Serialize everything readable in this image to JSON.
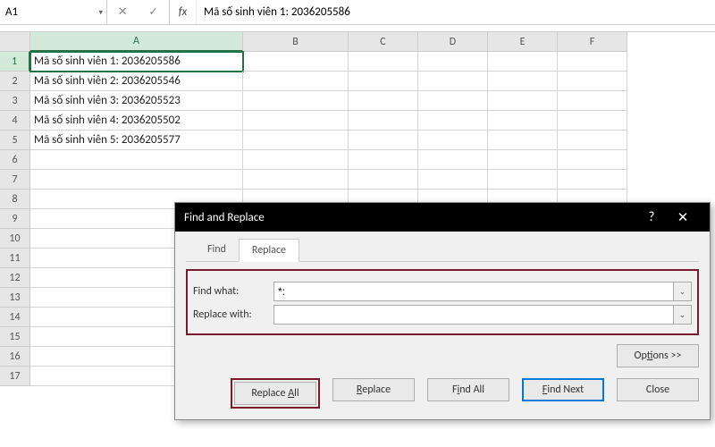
{
  "nameBox": "A1",
  "formulaBar": "Mã số sinh viên 1: 2036205586",
  "columns": [
    "A",
    "B",
    "C",
    "D",
    "E",
    "F"
  ],
  "selectedCol": "A",
  "selectedRow": 1,
  "rows": [
    "Mã số sinh viên 1: 2036205586",
    "Mã số sinh viên 2: 2036205546",
    "Mã số sinh viên 3: 2036205523",
    "Mã số sinh viên 4: 2036205502",
    "Mã số sinh viên 5: 2036205577"
  ],
  "totalRows": 17,
  "dialog": {
    "title": "Find and Replace",
    "tabs": {
      "find": "Find",
      "replace": "Replace"
    },
    "activeTab": "replace",
    "findLabel": "Find what:",
    "replaceLabel": "Replace with:",
    "findValue": "*:",
    "replaceValue": "",
    "optionsLabel": "Options >>",
    "buttons": {
      "replaceAll": {
        "pre": "Replace ",
        "u": "A",
        "post": "ll"
      },
      "replace": {
        "pre": "",
        "u": "R",
        "post": "eplace"
      },
      "findAll": {
        "pre": "Find A",
        "u": "l",
        "post": "l"
      },
      "findNext": {
        "pre": "",
        "u": "F",
        "post": "ind Next"
      },
      "close": "Close"
    }
  }
}
